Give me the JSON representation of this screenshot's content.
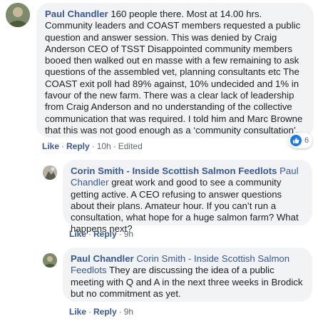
{
  "comments": [
    {
      "author": "Paul Chandler",
      "mention": "",
      "text": "160 people there. Most at 14.00 hrs. Community leaders and COAST members requested a public question and answer session. This was denied by Craig Anderson CEO of TSST Disappointed community members booed then walked out en masse with a few remaining to ask questions of the assembled vet, planning consultants etc The COAST exit poll had 89% against, 10% undecided and 1% in favour of the new farm. There was a clear lack of leadership from Craig Anderson and no understanding of the collective communication that was required. I told him and Marc Browne that this was not good enough as a ‘community consultation’.",
      "like_label": "Like",
      "reply_label": "Reply",
      "time": "10h",
      "edited": "Edited",
      "reaction_count": "6"
    },
    {
      "author": "Corin Smith - Inside Scottish Salmon Feedlots",
      "mention": "Paul Chandler",
      "text": "great work and good to see a community getting active. A CEO refusing to answer questions about their plans. Amateur hour. If you can’t run a consultation, what hope for a huge salmon farm? What happens next?",
      "like_label": "Like",
      "reply_label": "Reply",
      "time": "9h"
    },
    {
      "author": "Paul Chandler",
      "mention": "Corin Smith - Inside Scottish Salmon Feedlots",
      "text": "They are discussing the idea of a public meeting with Q and A in the next three weeks in Brodick but no commitment as yet.",
      "like_label": "Like",
      "reply_label": "Reply",
      "time": "9h"
    }
  ],
  "colors": {
    "link": "#385898",
    "bubble": "#f2f3f5",
    "meta": "#606770",
    "like_blue": "#1877f2"
  }
}
